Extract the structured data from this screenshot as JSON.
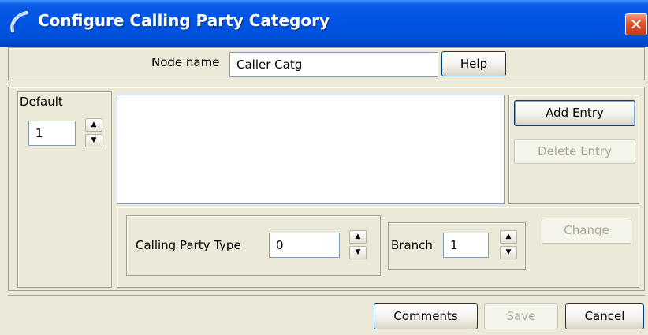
{
  "window": {
    "title": "Configure Calling Party Category",
    "close_glyph": "✕",
    "icon": "calling-party-icon"
  },
  "node": {
    "label": "Node name",
    "value": "Caller Catg",
    "help_label": "Help"
  },
  "default": {
    "label": "Default",
    "value": "1"
  },
  "entries": {
    "add_label": "Add Entry",
    "delete_label": "Delete Entry",
    "items": []
  },
  "calling_party_type": {
    "label": "Calling Party Type",
    "value": "0"
  },
  "branch": {
    "label": "Branch",
    "value": "1"
  },
  "change_label": "Change",
  "footer": {
    "comments_label": "Comments",
    "save_label": "Save",
    "cancel_label": "Cancel"
  },
  "spinner": {
    "up_glyph": "▲",
    "down_glyph": "▼"
  },
  "colors": {
    "titlebar": "#0054e3",
    "close": "#e0532e",
    "face": "#ece9d8"
  }
}
